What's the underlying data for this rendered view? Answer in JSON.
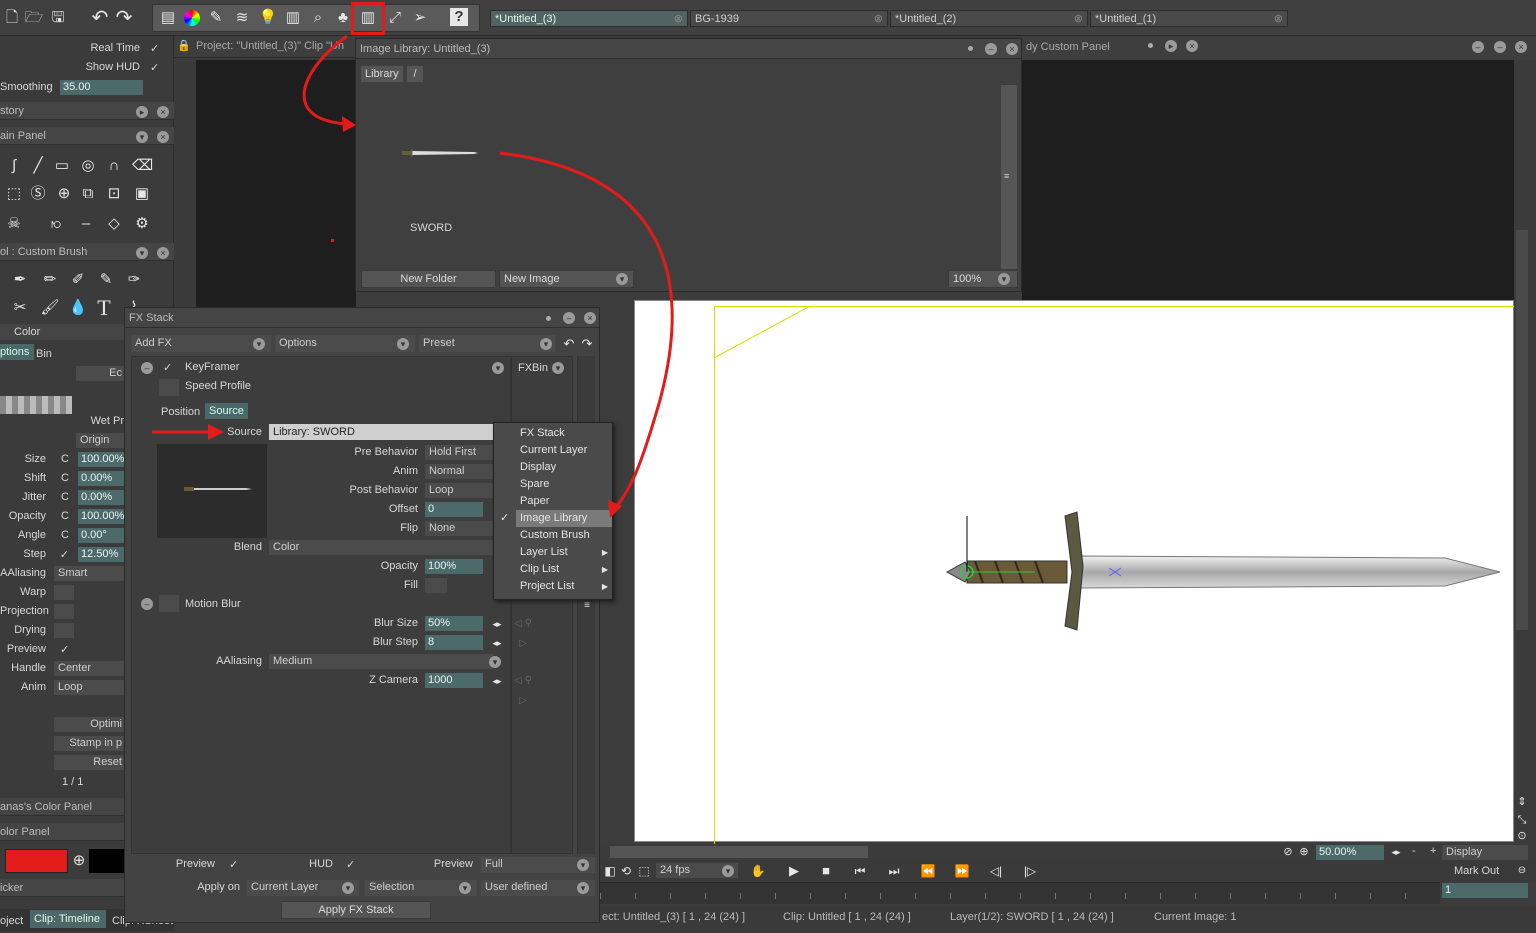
{
  "toolbar": {
    "tabs": [
      {
        "label": "*Untitled_(3)",
        "close": "⊗"
      },
      {
        "label": "BG-1939",
        "close": "⊗"
      },
      {
        "label": "*Untitled_(2)",
        "close": "⊗"
      },
      {
        "label": "*Untitled_(1)",
        "close": "⊗"
      }
    ]
  },
  "left": {
    "realtime": "Real Time",
    "showhud": "Show HUD",
    "smoothing_label": "Smoothing",
    "smoothing_value": "35.00",
    "history": "story",
    "main_panel": "ain Panel",
    "custom_brush": "ol : Custom Brush",
    "color_tab": "Color",
    "options_tab": "ptions",
    "bin_tab": "Bin",
    "ec": "Ec",
    "wetpr": "Wet Pr",
    "origin": "Origin",
    "params": [
      {
        "label": "Size",
        "c": "C",
        "value": "100.00%"
      },
      {
        "label": "Shift",
        "c": "C",
        "value": "0.00%"
      },
      {
        "label": "Jitter",
        "c": "C",
        "value": "0.00%"
      },
      {
        "label": "Opacity",
        "c": "C",
        "value": "100.00%"
      },
      {
        "label": "Angle",
        "c": "C",
        "value": "0.00°"
      },
      {
        "label": "Step",
        "c": "✓",
        "value": "12.50%"
      }
    ],
    "aaliasing_label": "AAliasing",
    "aaliasing_value": "Smart",
    "warp": "Warp",
    "projection": "Projection",
    "drying": "Drying",
    "preview": "Preview",
    "handle_label": "Handle",
    "handle_value": "Center",
    "anim_label": "Anim",
    "anim_value": "Loop",
    "optimi": "Optimi",
    "stamp": "Stamp in p",
    "reset": "Reset",
    "page": "1 / 1",
    "color_panel1": "anas's Color Panel",
    "color_panel2": "olor Panel",
    "picker": "icker",
    "bottom_tabs": [
      "oject",
      "Clip: Timeline",
      "Clip: XSheet"
    ]
  },
  "project_bar": "Project:  \"Untitled_(3)\"  Clip  \"Un",
  "image_library": {
    "title": "Image Library: Untitled_(3)",
    "tab_library": "Library",
    "tab_slash": "/",
    "item_label": "SWORD",
    "new_folder": "New Folder",
    "new_image": "New Image",
    "zoom": "100%"
  },
  "custom_panel": "dy Custom Panel",
  "fxstack": {
    "title": "FX Stack",
    "add_fx": "Add FX",
    "options": "Options",
    "preset": "Preset",
    "fxbin": "FXBin",
    "keyframer": "KeyFramer",
    "speed_profile": "Speed Profile",
    "tab_position": "Position",
    "tab_source": "Source",
    "source_label": "Source",
    "source_value": "Library: SWORD",
    "pre_behavior_label": "Pre Behavior",
    "pre_behavior_value": "Hold First",
    "anim_label": "Anim",
    "anim_value": "Normal",
    "post_behavior_label": "Post Behavior",
    "post_behavior_value": "Loop",
    "offset_label": "Offset",
    "offset_value": "0",
    "flip_label": "Flip",
    "flip_value": "None",
    "blend_label": "Blend",
    "blend_value": "Color",
    "opacity_label": "Opacity",
    "opacity_value": "100%",
    "fill_label": "Fill",
    "motion_blur": "Motion Blur",
    "blur_size_label": "Blur Size",
    "blur_size_value": "50%",
    "blur_step_label": "Blur Step",
    "blur_step_value": "8",
    "aaliasing_label": "AAliasing",
    "aaliasing_value": "Medium",
    "zcamera_label": "Z Camera",
    "zcamera_value": "1000",
    "preview_label": "Preview",
    "hud_label": "HUD",
    "preview2_label": "Preview",
    "preview2_value": "Full",
    "apply_on_label": "Apply on",
    "apply_on_value": "Current Layer",
    "selection": "Selection",
    "user_defined": "User defined",
    "apply_button": "Apply FX Stack"
  },
  "source_menu": {
    "items": [
      {
        "label": "FX Stack",
        "check": "",
        "arrow": ""
      },
      {
        "label": "Current Layer",
        "check": "",
        "arrow": ""
      },
      {
        "label": "Display",
        "check": "",
        "arrow": ""
      },
      {
        "label": "Spare",
        "check": "",
        "arrow": ""
      },
      {
        "label": "Paper",
        "check": "",
        "arrow": ""
      },
      {
        "label": "Image Library",
        "check": "✓",
        "arrow": ""
      },
      {
        "label": "Custom Brush",
        "check": "",
        "arrow": ""
      },
      {
        "label": "Layer List",
        "check": "",
        "arrow": "▶"
      },
      {
        "label": "Clip List",
        "check": "",
        "arrow": "▶"
      },
      {
        "label": "Project List",
        "check": "",
        "arrow": "▶"
      }
    ]
  },
  "viewport": {
    "zoom": "50.00%",
    "display": "Display",
    "minus": "-",
    "plus": "+"
  },
  "playback": {
    "fps": "24 fps",
    "markout": "Mark Out",
    "frame": "1"
  },
  "status": {
    "project": "ect: Untitled_(3) [ 1 , 24  (24) ]",
    "clip": "Clip: Untitled [ 1 , 24  (24) ]",
    "layer": "Layer(1/2): SWORD [ 1 , 24  (24) ]",
    "current": "Current Image: 1"
  },
  "colors": {
    "accent_red": "#e41b1b",
    "field": "#4d6a6a",
    "menu_selected": "#7a7a7a"
  }
}
